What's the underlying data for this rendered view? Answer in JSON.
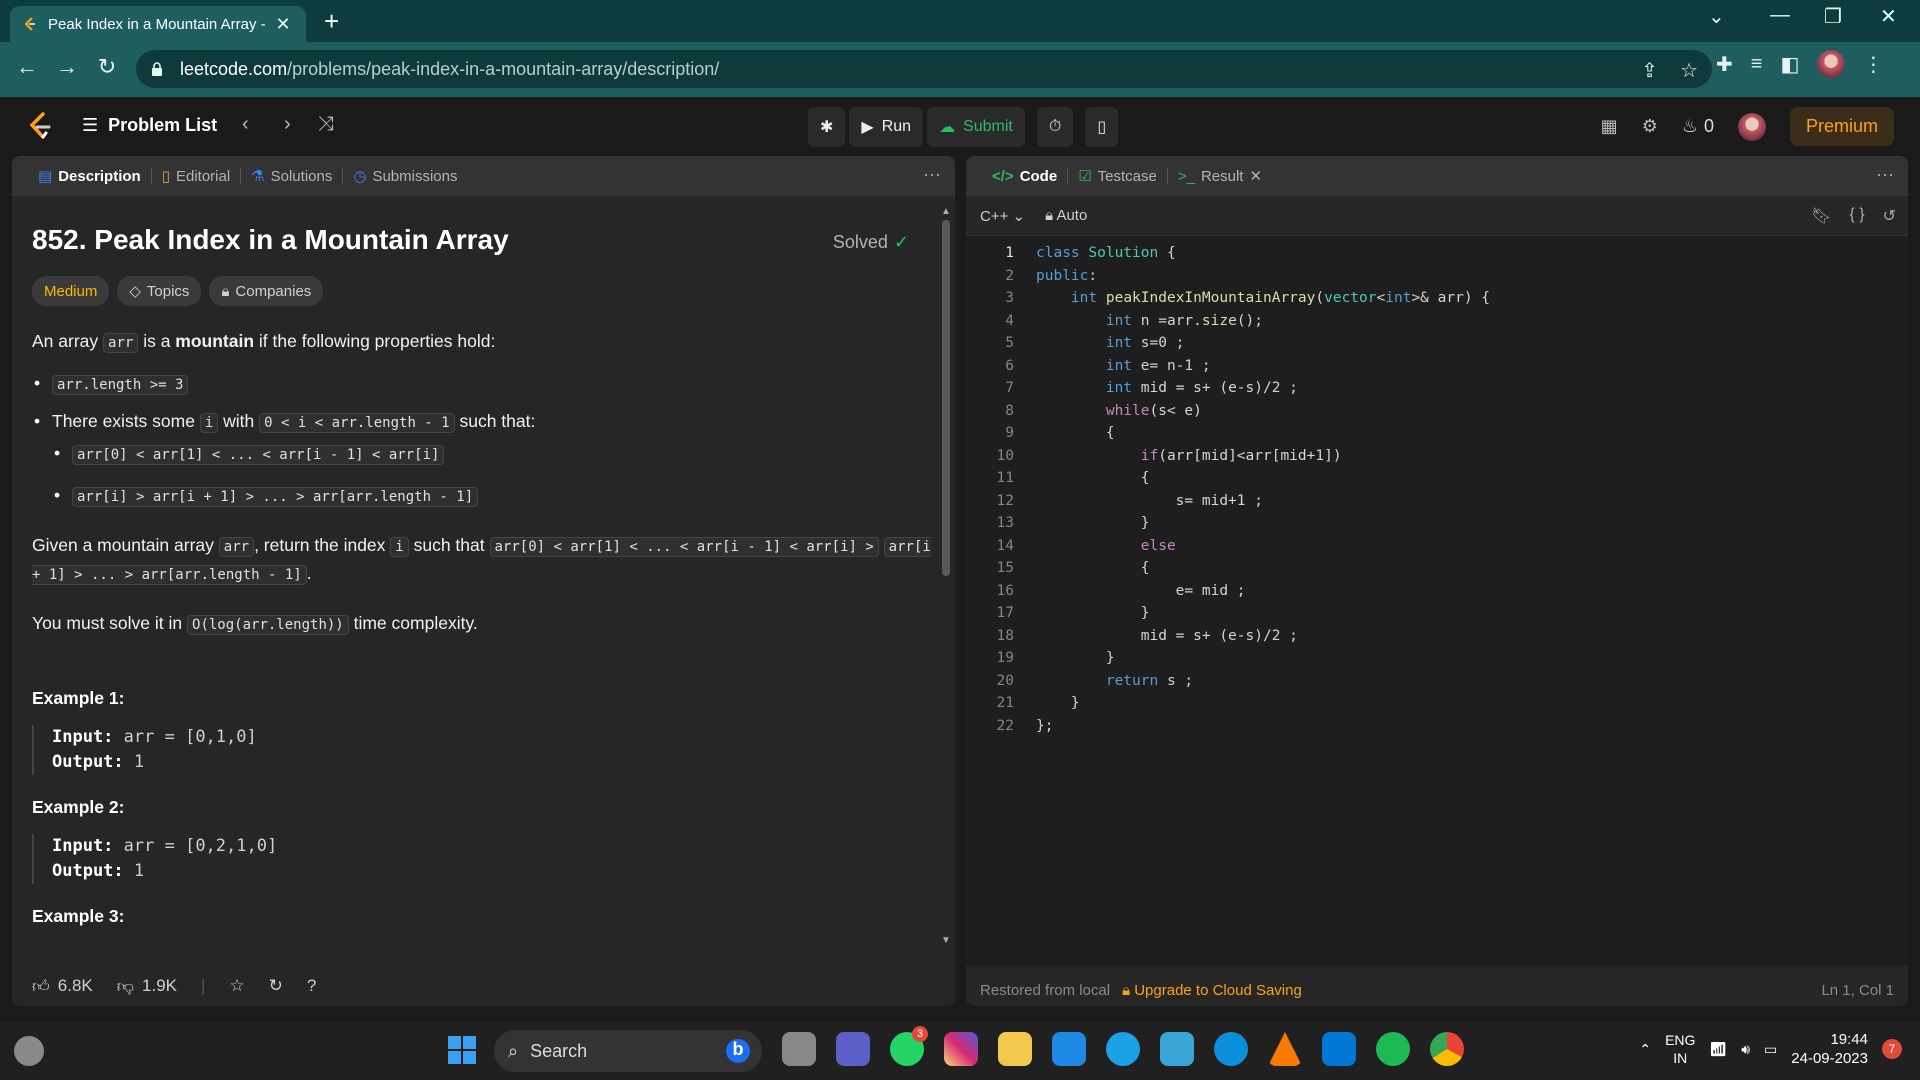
{
  "browser": {
    "tab_title": "Peak Index in a Mountain Array -",
    "url_host": "leetcode.com",
    "url_path": "/problems/peak-index-in-a-mountain-array/description/"
  },
  "lc_nav": {
    "problem_list": "Problem List",
    "run": "Run",
    "submit": "Submit",
    "streak": "0",
    "premium": "Premium"
  },
  "left_tabs": [
    "Description",
    "Editorial",
    "Solutions",
    "Submissions"
  ],
  "problem": {
    "title": "852. Peak Index in a Mountain Array",
    "solved": "Solved",
    "difficulty": "Medium",
    "topics": "Topics",
    "companies": "Companies",
    "p1_a": "An array",
    "p1_code": "arr",
    "p1_b": "is a",
    "p1_bold": "mountain",
    "p1_c": "if the following properties hold:",
    "b1_code": "arr.length >= 3",
    "b2_a": "There exists some",
    "b2_i": "i",
    "b2_with": "with",
    "b2_code": "0 < i < arr.length - 1",
    "b2_b": "such that:",
    "sub1": "arr[0] < arr[1] < ... < arr[i - 1] < arr[i]",
    "sub2": "arr[i] > arr[i + 1] > ... > arr[arr.length - 1]",
    "p2_a": "Given a mountain array",
    "p2_arr": "arr",
    "p2_b": ", return the index",
    "p2_i": "i",
    "p2_c": "such that",
    "p2_code1": "arr[0] < arr[1] < ... < arr[i - 1] < arr[i] >",
    "p2_code2": "arr[i + 1] > ... > arr[arr.length - 1]",
    "p2_end": ".",
    "p3_a": "You must solve it in",
    "p3_code": "O(log(arr.length))",
    "p3_b": "time complexity.",
    "ex1_title": "Example 1:",
    "ex1_input": "arr = [0,1,0]",
    "ex1_output": "1",
    "ex2_title": "Example 2:",
    "ex2_input": "arr = [0,2,1,0]",
    "ex2_output": "1",
    "ex3_title": "Example 3:",
    "input_label": "Input:",
    "output_label": "Output:",
    "likes": "6.8K",
    "dislikes": "1.9K"
  },
  "right_tabs": [
    "Code",
    "Testcase",
    "Result"
  ],
  "editor": {
    "language": "C++",
    "mode": "Auto",
    "footer_restored": "Restored from local",
    "footer_upgrade": "Upgrade to Cloud Saving",
    "cursor": "Ln 1, Col 1",
    "lines": [
      "class Solution {",
      "public:",
      "    int peakIndexInMountainArray(vector<int>& arr) {",
      "        int n =arr.size();",
      "        int s=0 ;",
      "        int e= n-1 ;",
      "        int mid = s+ (e-s)/2 ;",
      "        while(s< e)",
      "        {",
      "            if(arr[mid]<arr[mid+1])",
      "            {",
      "                s= mid+1 ;",
      "            }",
      "            else",
      "            {",
      "                e= mid ;",
      "            }",
      "            mid = s+ (e-s)/2 ;",
      "        }",
      "        return s ;",
      "    }",
      "};"
    ]
  },
  "taskbar": {
    "search": "Search",
    "whatsapp_badge": "3",
    "lang1": "ENG",
    "lang2": "IN",
    "time": "19:44",
    "date": "24-09-2023",
    "notifications": "7"
  }
}
